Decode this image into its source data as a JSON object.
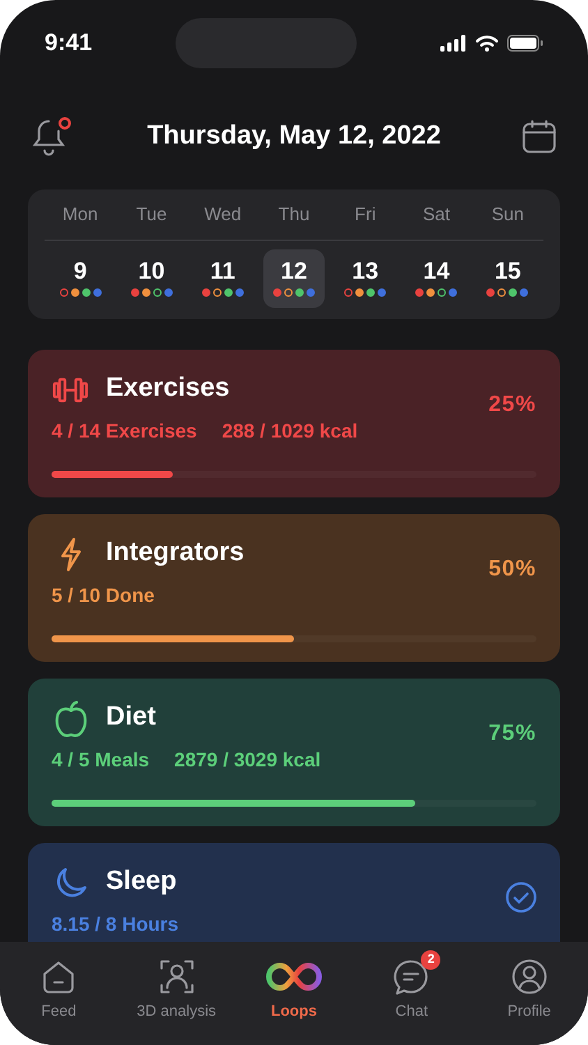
{
  "status_bar": {
    "time": "9:41"
  },
  "header": {
    "title": "Thursday, May 12, 2022",
    "has_notification": true
  },
  "week": [
    {
      "weekday": "Mon",
      "day": "9",
      "selected": false,
      "dots": [
        {
          "color": "#e8423f",
          "filled": false
        },
        {
          "color": "#f0903e",
          "filled": true
        },
        {
          "color": "#4fc46b",
          "filled": true
        },
        {
          "color": "#3f6fdc",
          "filled": true
        }
      ]
    },
    {
      "weekday": "Tue",
      "day": "10",
      "selected": false,
      "dots": [
        {
          "color": "#e8423f",
          "filled": true
        },
        {
          "color": "#f0903e",
          "filled": true
        },
        {
          "color": "#4fc46b",
          "filled": false
        },
        {
          "color": "#3f6fdc",
          "filled": true
        }
      ]
    },
    {
      "weekday": "Wed",
      "day": "11",
      "selected": false,
      "dots": [
        {
          "color": "#e8423f",
          "filled": true
        },
        {
          "color": "#f0903e",
          "filled": false
        },
        {
          "color": "#4fc46b",
          "filled": true
        },
        {
          "color": "#3f6fdc",
          "filled": true
        }
      ]
    },
    {
      "weekday": "Thu",
      "day": "12",
      "selected": true,
      "dots": [
        {
          "color": "#e8423f",
          "filled": true
        },
        {
          "color": "#f0903e",
          "filled": false
        },
        {
          "color": "#4fc46b",
          "filled": true
        },
        {
          "color": "#3f6fdc",
          "filled": true
        }
      ]
    },
    {
      "weekday": "Fri",
      "day": "13",
      "selected": false,
      "dots": [
        {
          "color": "#e8423f",
          "filled": false
        },
        {
          "color": "#f0903e",
          "filled": true
        },
        {
          "color": "#4fc46b",
          "filled": true
        },
        {
          "color": "#3f6fdc",
          "filled": true
        }
      ]
    },
    {
      "weekday": "Sat",
      "day": "14",
      "selected": false,
      "dots": [
        {
          "color": "#e8423f",
          "filled": true
        },
        {
          "color": "#f0903e",
          "filled": true
        },
        {
          "color": "#4fc46b",
          "filled": false
        },
        {
          "color": "#3f6fdc",
          "filled": true
        }
      ]
    },
    {
      "weekday": "Sun",
      "day": "15",
      "selected": false,
      "dots": [
        {
          "color": "#e8423f",
          "filled": true
        },
        {
          "color": "#f0903e",
          "filled": false
        },
        {
          "color": "#4fc46b",
          "filled": true
        },
        {
          "color": "#3f6fdc",
          "filled": true
        }
      ]
    }
  ],
  "cards": [
    {
      "kind": "exercises",
      "title": "Exercises",
      "stats": [
        "4 / 14 Exercises",
        "288 / 1029 kcal"
      ],
      "percent": "25%",
      "level": 0.25
    },
    {
      "kind": "integrators",
      "title": "Integrators",
      "stats": [
        "5 / 10 Done"
      ],
      "percent": "50%",
      "level": 0.5
    },
    {
      "kind": "diet",
      "title": "Diet",
      "stats": [
        "4 / 5 Meals",
        "2879 / 3029 kcal"
      ],
      "percent": "75%",
      "level": 0.75
    },
    {
      "kind": "sleep",
      "title": "Sleep",
      "stats": [
        "8.15 / 8 Hours"
      ],
      "done": true
    }
  ],
  "nav": [
    {
      "kind": "feed",
      "label": "Feed",
      "selected": false
    },
    {
      "kind": "analysis",
      "label": "3D analysis",
      "selected": false
    },
    {
      "kind": "loops",
      "label": "Loops",
      "selected": true
    },
    {
      "kind": "chat",
      "label": "Chat",
      "selected": false,
      "badge": "2"
    },
    {
      "kind": "profile",
      "label": "Profile",
      "selected": false
    }
  ]
}
